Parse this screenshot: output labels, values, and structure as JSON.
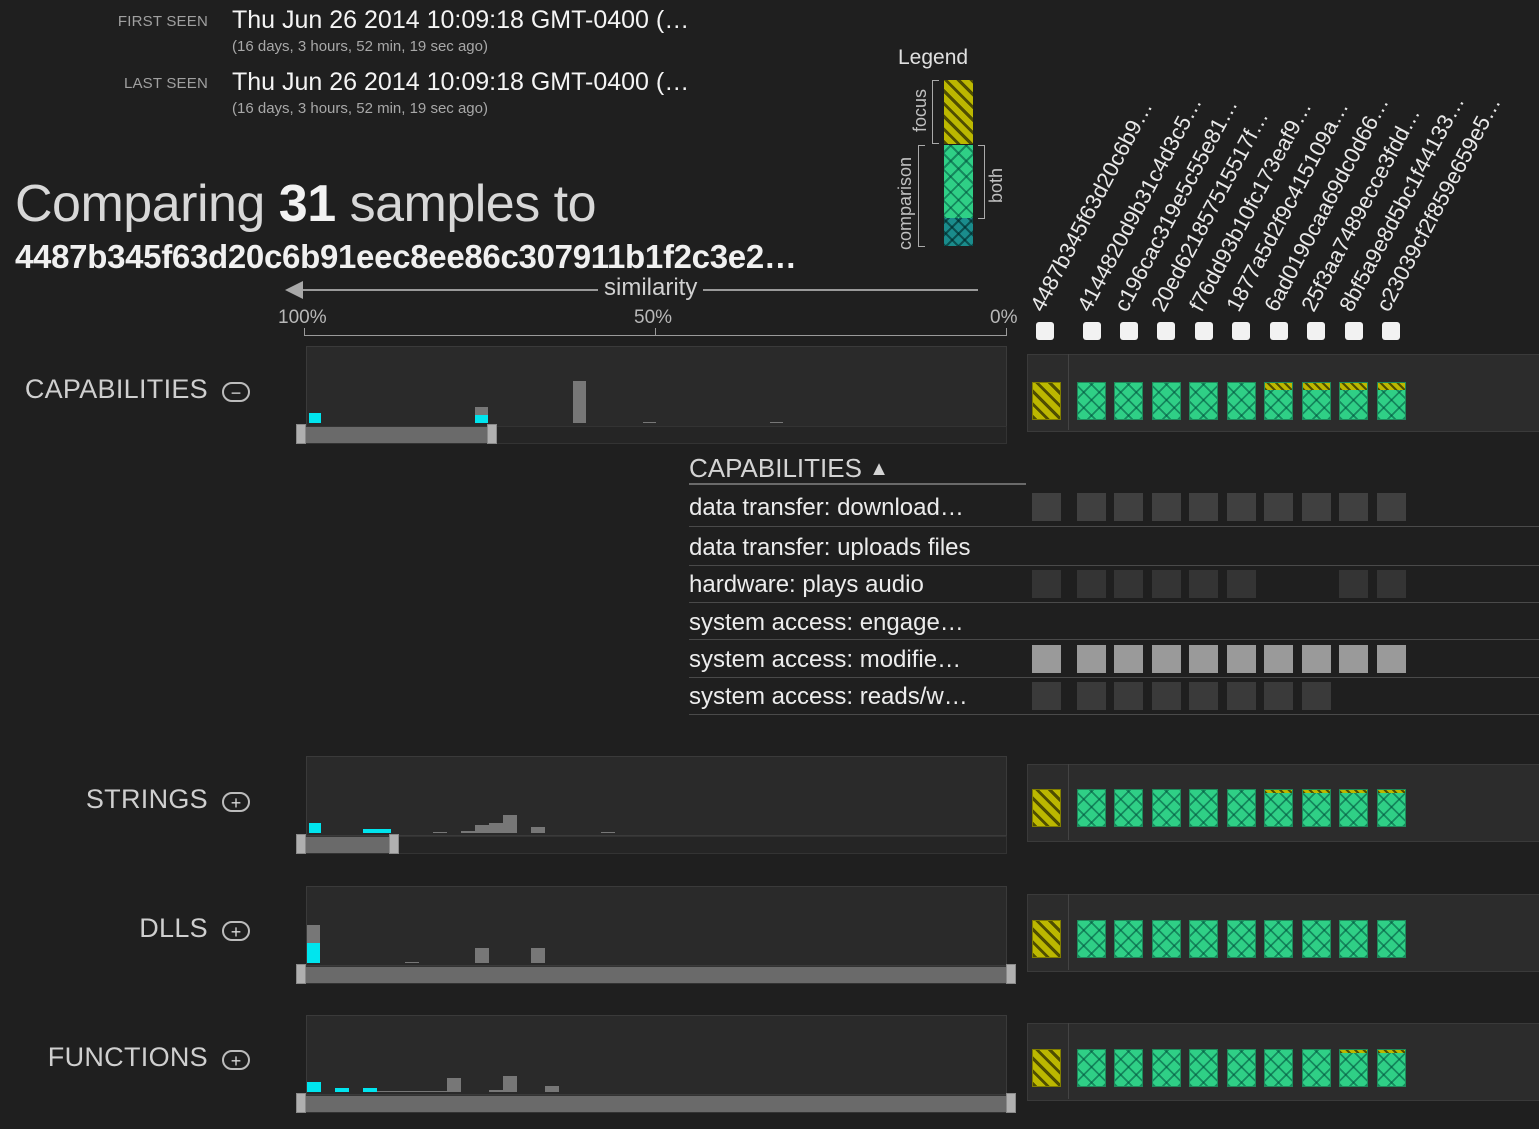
{
  "first_seen": {
    "label": "FIRST SEEN",
    "date": "Thu Jun 26 2014 10:09:18 GMT-0400 (…",
    "ago": "(16 days, 3 hours, 52 min, 19 sec ago)"
  },
  "last_seen": {
    "label": "LAST SEEN",
    "date": "Thu Jun 26 2014 10:09:18 GMT-0400 (…",
    "ago": "(16 days, 3 hours, 52 min, 19 sec ago)"
  },
  "comparison": {
    "prefix": "Comparing",
    "count": "31",
    "suffix": "samples to",
    "focus_hash": "4487b345f63d20c6b91eec8ee86c307911b1f2c3e2…"
  },
  "legend": {
    "title": "Legend",
    "focus": "focus",
    "comparison": "comparison",
    "both": "both",
    "colors": {
      "focus": "#bcb800",
      "both": "#2fcf86",
      "comparison": "#1a8c8c"
    }
  },
  "similarity_axis": {
    "label": "similarity",
    "ticks": [
      "100%",
      "50%",
      "0%"
    ]
  },
  "columns": [
    "4487b345f63d20c6b9…",
    "4144820d9b31c4d3c5…",
    "c196cac319e5c55e81…",
    "20ed621857515517f…",
    "f76dd93b10fc173eaf9…",
    "1877a5d2f9c415109a…",
    "6ad0190caa69dc0d66…",
    "25f3aa7489ecce3fdd…",
    "8bf5a9e8d5bc1f44133…",
    "c23039cf2f859e659e5…"
  ],
  "sections": [
    {
      "name": "CAPABILITIES",
      "toggle": "−",
      "expanded": true
    },
    {
      "name": "STRINGS",
      "toggle": "+",
      "expanded": false
    },
    {
      "name": "DLLS",
      "toggle": "+",
      "expanded": false
    },
    {
      "name": "FUNCTIONS",
      "toggle": "+",
      "expanded": false
    }
  ],
  "capabilities_detail": {
    "header": "CAPABILITIES",
    "header_icon": "chevron-up-icon",
    "rows": [
      "data transfer: download…",
      "data transfer: uploads files",
      "hardware: plays audio",
      "system access: engage…",
      "system access: modifie…",
      "system access: reads/w…"
    ]
  }
}
